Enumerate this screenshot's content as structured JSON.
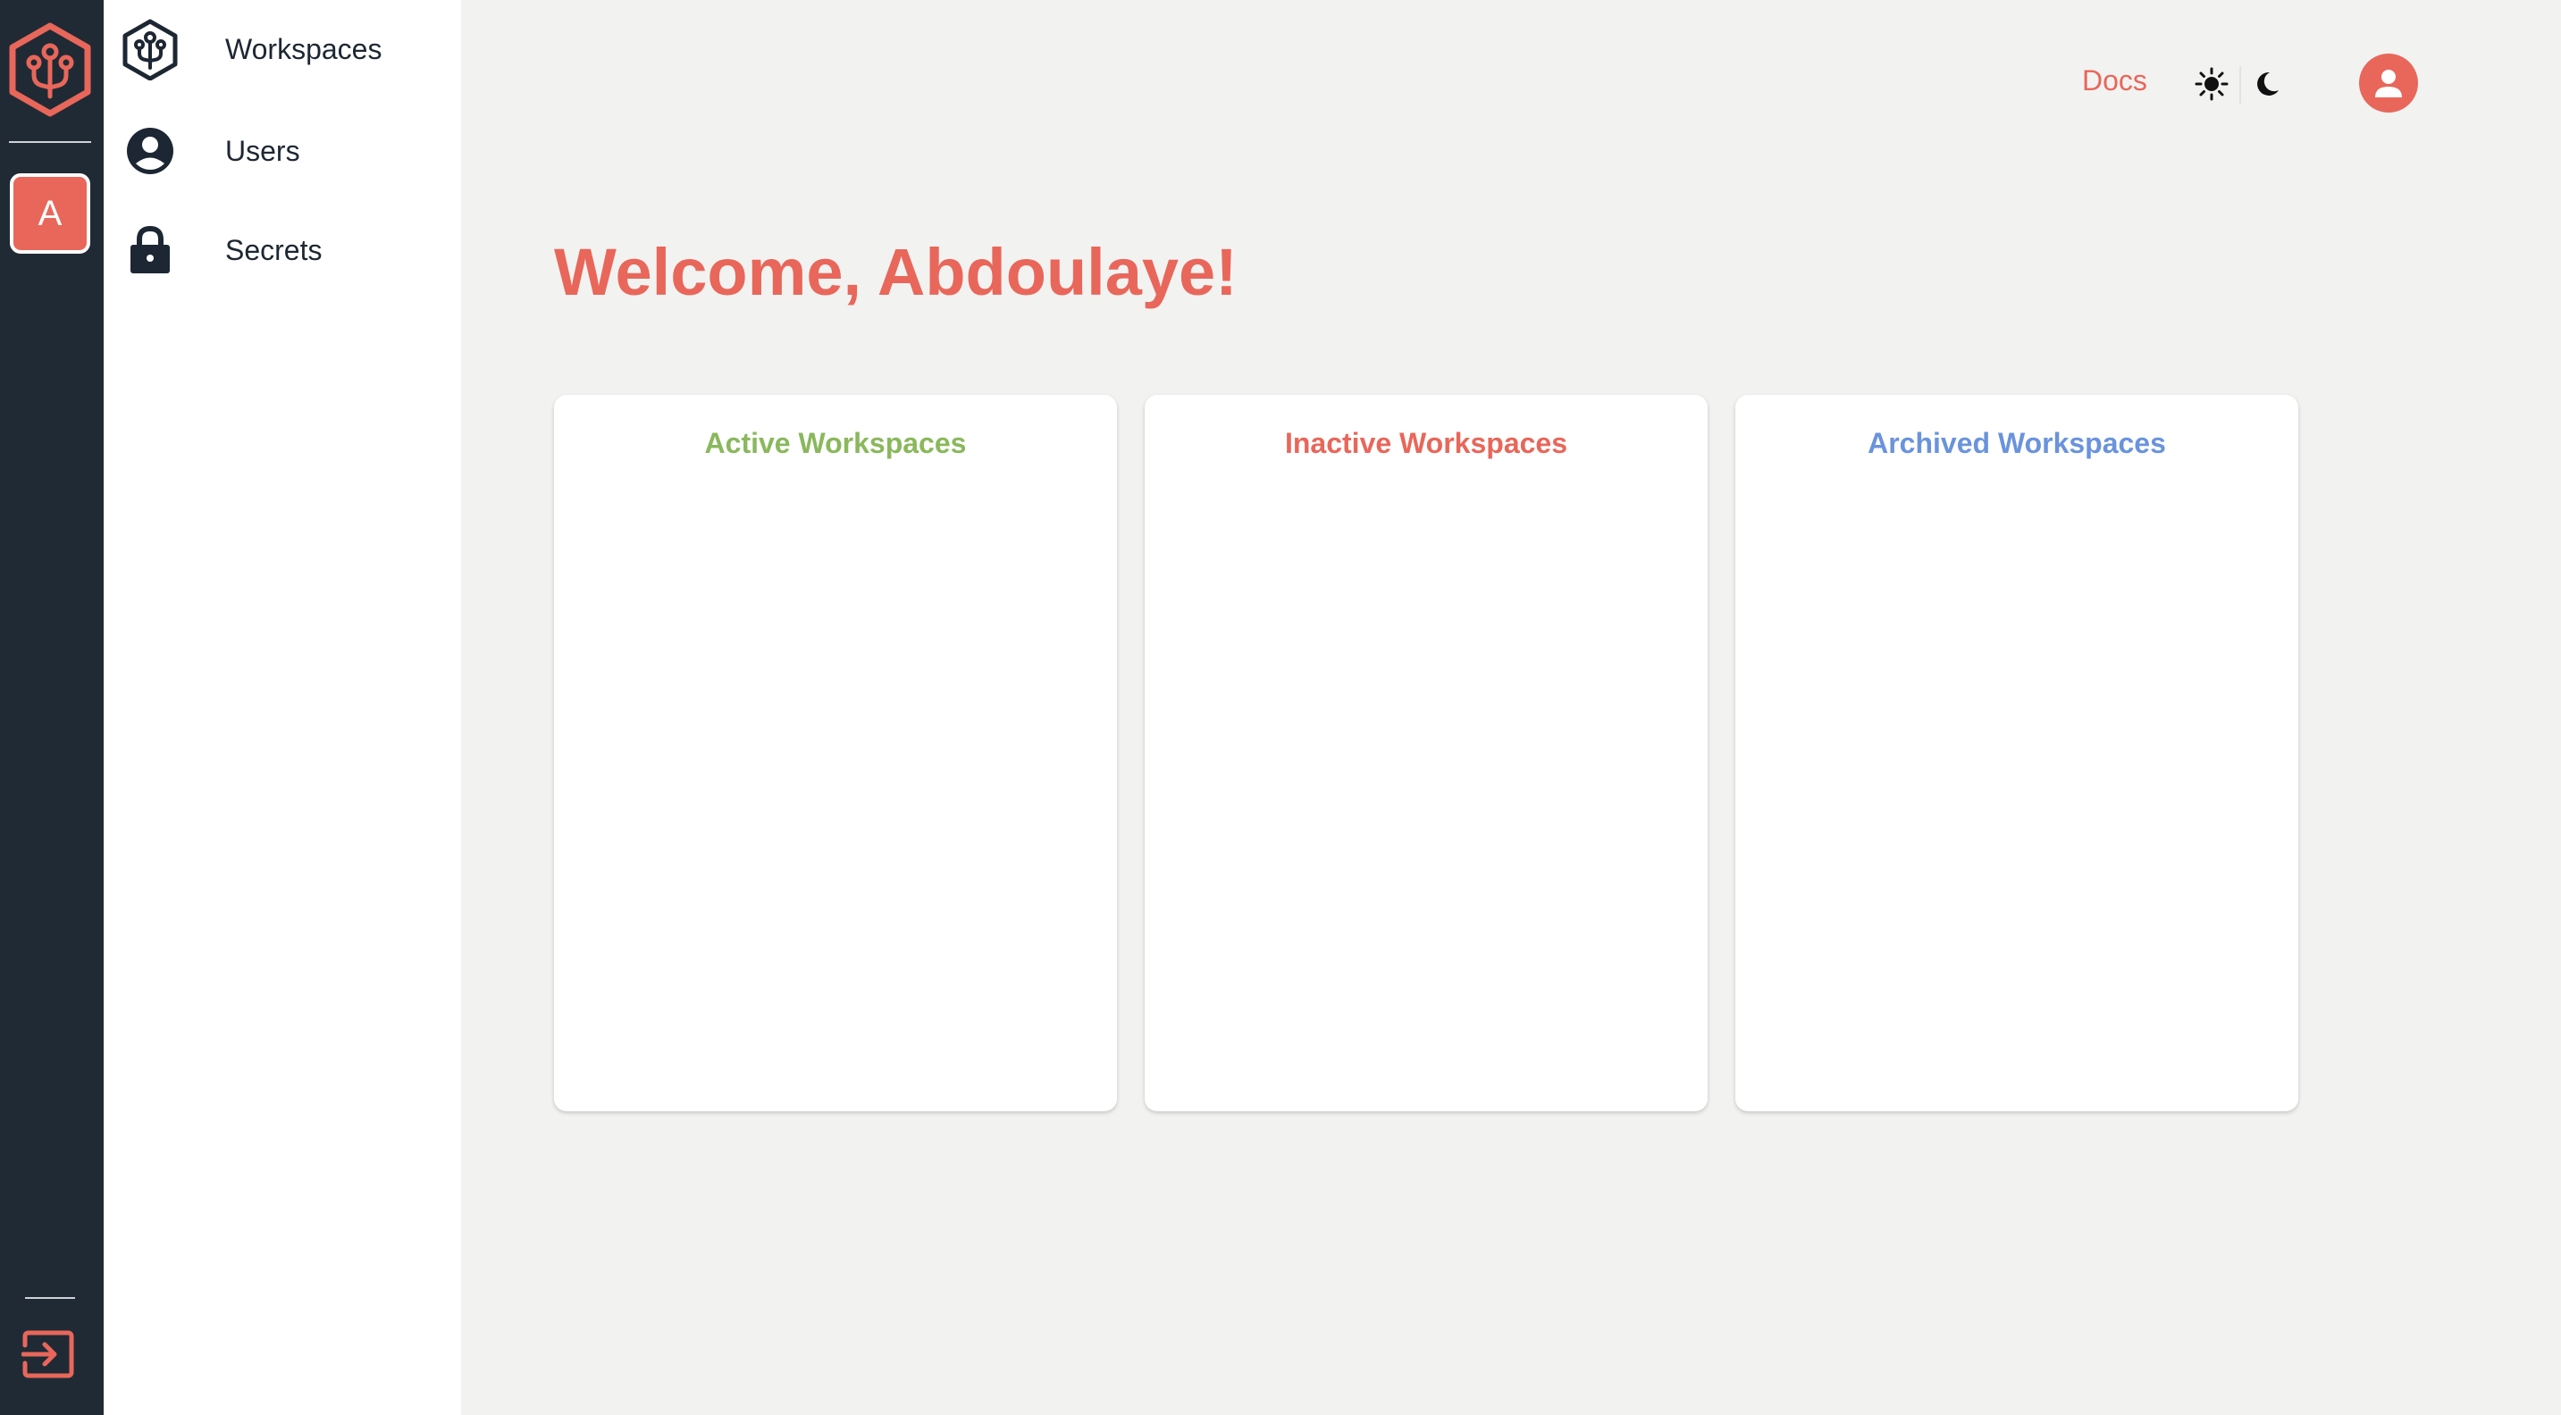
{
  "rail": {
    "logo_icon": "hexagon-logo-icon",
    "workspace_avatar_letter": "A",
    "logout_icon": "logout-icon"
  },
  "nav": {
    "items": [
      {
        "label": "Workspaces",
        "icon": "workspaces-hex-icon"
      },
      {
        "label": "Users",
        "icon": "user-circle-icon"
      },
      {
        "label": "Secrets",
        "icon": "lock-icon"
      }
    ]
  },
  "header": {
    "docs_label": "Docs",
    "theme_light_icon": "sun-icon",
    "theme_dark_icon": "moon-icon",
    "account_icon": "account-avatar-icon"
  },
  "main": {
    "welcome": "Welcome, Abdoulaye!",
    "cards": [
      {
        "title": "Active Workspaces",
        "color": "#8ab85c"
      },
      {
        "title": "Inactive Workspaces",
        "color": "#e8675a"
      },
      {
        "title": "Archived Workspaces",
        "color": "#6a93dc"
      }
    ]
  },
  "colors": {
    "accent": "#e8675a",
    "rail_bg": "#202a35",
    "page_bg": "#f2f2f1"
  }
}
